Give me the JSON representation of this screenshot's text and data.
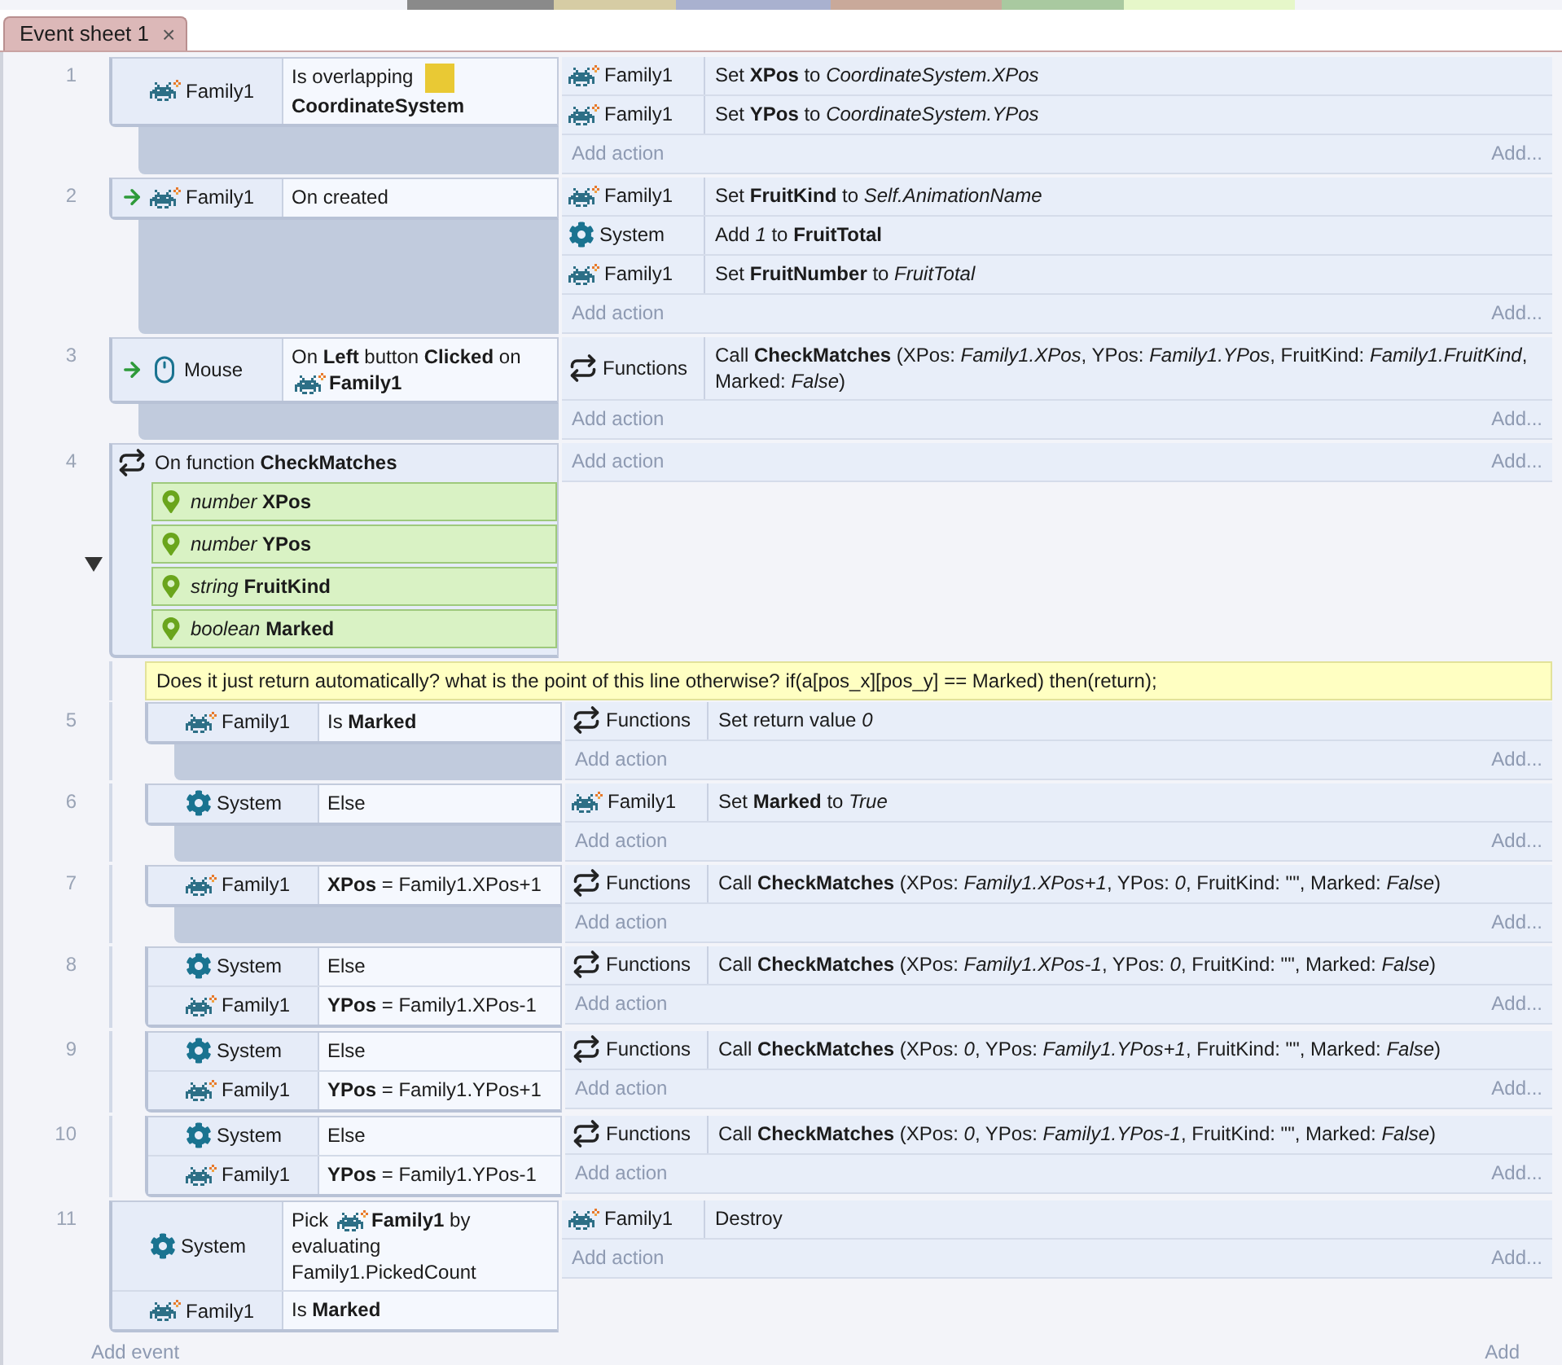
{
  "tab": {
    "label": "Event sheet 1",
    "close": "×"
  },
  "events": [
    {
      "number": "1",
      "trigger": false,
      "conditions": [
        {
          "kind": "family",
          "object": "Family1",
          "parts": [
            {
              "kind": "text",
              "text": "Is overlapping"
            },
            {
              "kind": "swatch"
            },
            {
              "kind": "text",
              "text": "**CoordinateSystem**"
            }
          ]
        }
      ],
      "actions": [
        {
          "kind": "family",
          "object": "Family1",
          "text": "Set **XPos** to *CoordinateSystem.XPos*"
        },
        {
          "kind": "family",
          "object": "Family1",
          "text": "Set **YPos** to *CoordinateSystem.YPos*"
        }
      ],
      "add_action": "Add action",
      "add_more": "Add..."
    },
    {
      "number": "2",
      "trigger": true,
      "conditions": [
        {
          "kind": "family",
          "object": "Family1",
          "parts": [
            {
              "kind": "text",
              "text": "On created"
            }
          ]
        }
      ],
      "actions": [
        {
          "kind": "family",
          "object": "Family1",
          "text": "Set **FruitKind** to *Self.AnimationName*"
        },
        {
          "kind": "system",
          "object": "System",
          "text": "Add *1* to **FruitTotal**"
        },
        {
          "kind": "family",
          "object": "Family1",
          "text": "Set **FruitNumber** to *FruitTotal*"
        }
      ],
      "add_action": "Add action",
      "add_more": "Add..."
    },
    {
      "number": "3",
      "trigger": true,
      "conditions": [
        {
          "kind": "mouse",
          "object": "Mouse",
          "parts": [
            {
              "kind": "text",
              "text": "On **Left** button **Clicked** on"
            },
            {
              "kind": "family"
            },
            {
              "kind": "text",
              "text": "**Family1**"
            }
          ]
        }
      ],
      "actions": [
        {
          "kind": "functions",
          "object": "Functions",
          "text": "Call **CheckMatches** (XPos: *Family1.XPos*, YPos: *Family1.YPos*, FruitKind: *Family1.FruitKind*, Marked: *False*)"
        }
      ],
      "add_action": "Add action",
      "add_more": "Add..."
    },
    {
      "number": "4",
      "expanded": true,
      "function": {
        "text": "On function **CheckMatches**",
        "params": [
          {
            "text": "*number* **XPos**"
          },
          {
            "text": "*number* **YPos**"
          },
          {
            "text": "*string* **FruitKind**"
          },
          {
            "text": "*boolean* **Marked**"
          }
        ]
      },
      "add_action": "Add action",
      "add_more": "Add...",
      "children": [
        {
          "number": "5",
          "trigger": false,
          "comment": "Does it just return automatically? what is the point of this line otherwise? if(a[pos_x][pos_y] == Marked) then(return);",
          "conditions": [
            {
              "kind": "family",
              "object": "Family1",
              "parts": [
                {
                  "kind": "text",
                  "text": "Is **Marked**"
                }
              ]
            }
          ],
          "actions": [
            {
              "kind": "functions",
              "object": "Functions",
              "text": "Set return value *0*"
            }
          ],
          "add_action": "Add action",
          "add_more": "Add..."
        },
        {
          "number": "6",
          "trigger": false,
          "conditions": [
            {
              "kind": "system",
              "object": "System",
              "parts": [
                {
                  "kind": "text",
                  "text": "Else"
                }
              ]
            }
          ],
          "actions": [
            {
              "kind": "family",
              "object": "Family1",
              "text": "Set **Marked** to *True*"
            }
          ],
          "add_action": "Add action",
          "add_more": "Add..."
        },
        {
          "number": "7",
          "trigger": false,
          "conditions": [
            {
              "kind": "family",
              "object": "Family1",
              "parts": [
                {
                  "kind": "text",
                  "text": "**XPos** = Family1.XPos+1"
                }
              ]
            }
          ],
          "actions": [
            {
              "kind": "functions",
              "object": "Functions",
              "text": "Call **CheckMatches** (XPos: *Family1.XPos+1*, YPos: *0*, FruitKind: \"\", Marked: *False*)"
            }
          ],
          "add_action": "Add action",
          "add_more": "Add..."
        },
        {
          "number": "8",
          "trigger": false,
          "conditions": [
            {
              "kind": "system",
              "object": "System",
              "parts": [
                {
                  "kind": "text",
                  "text": "Else"
                }
              ]
            },
            {
              "kind": "family",
              "object": "Family1",
              "parts": [
                {
                  "kind": "text",
                  "text": "**YPos** = Family1.XPos-1"
                }
              ]
            }
          ],
          "actions": [
            {
              "kind": "functions",
              "object": "Functions",
              "text": "Call **CheckMatches** (XPos: *Family1.XPos-1*, YPos: *0*, FruitKind: \"\", Marked: *False*)"
            }
          ],
          "add_action": "Add action",
          "add_more": "Add..."
        },
        {
          "number": "9",
          "trigger": false,
          "conditions": [
            {
              "kind": "system",
              "object": "System",
              "parts": [
                {
                  "kind": "text",
                  "text": "Else"
                }
              ]
            },
            {
              "kind": "family",
              "object": "Family1",
              "parts": [
                {
                  "kind": "text",
                  "text": "**YPos** = Family1.YPos+1"
                }
              ]
            }
          ],
          "actions": [
            {
              "kind": "functions",
              "object": "Functions",
              "text": "Call **CheckMatches** (XPos: *0*, YPos: *Family1.YPos+1*, FruitKind: \"\", Marked: *False*)"
            }
          ],
          "add_action": "Add action",
          "add_more": "Add..."
        },
        {
          "number": "10",
          "trigger": false,
          "conditions": [
            {
              "kind": "system",
              "object": "System",
              "parts": [
                {
                  "kind": "text",
                  "text": "Else"
                }
              ]
            },
            {
              "kind": "family",
              "object": "Family1",
              "parts": [
                {
                  "kind": "text",
                  "text": "**YPos** = Family1.YPos-1"
                }
              ]
            }
          ],
          "actions": [
            {
              "kind": "functions",
              "object": "Functions",
              "text": "Call **CheckMatches** (XPos: *0*, YPos: *Family1.YPos-1*, FruitKind: \"\", Marked: *False*)"
            }
          ],
          "add_action": "Add action",
          "add_more": "Add..."
        }
      ]
    },
    {
      "number": "11",
      "trigger": false,
      "conditions": [
        {
          "kind": "system",
          "object": "System",
          "parts": [
            {
              "kind": "text",
              "text": "Pick"
            },
            {
              "kind": "family"
            },
            {
              "kind": "text",
              "text": "**Family1** by evaluating Family1.PickedCount"
            }
          ]
        },
        {
          "kind": "family",
          "object": "Family1",
          "parts": [
            {
              "kind": "text",
              "text": "Is **Marked**"
            }
          ]
        }
      ],
      "actions": [
        {
          "kind": "family",
          "object": "Family1",
          "text": "Destroy"
        }
      ],
      "add_action": "Add action",
      "add_more": "Add..."
    }
  ],
  "footer": {
    "add_event": "Add event",
    "add": "Add"
  }
}
